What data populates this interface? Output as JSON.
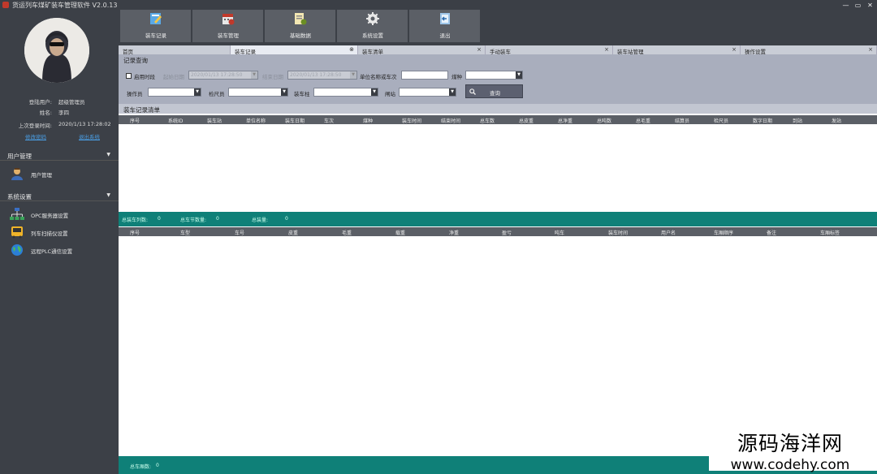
{
  "window": {
    "title": "货运列车煤矿装车管理软件 V2.0.13",
    "controls": [
      "—",
      "▭",
      "✕"
    ]
  },
  "user": {
    "login_user_label": "登陆用户:",
    "login_user": "超级管理员",
    "name_label": "姓名:",
    "name": "李四",
    "last_login_label": "上次登录时间:",
    "last_login": "2020/1/13 17:28:02",
    "link_change_password": "修改密码",
    "link_logout": "退出系统"
  },
  "sidebar": {
    "sections": [
      {
        "label": "用户管理",
        "items": [
          {
            "label": "用户管理",
            "icon": "user-icon"
          }
        ]
      },
      {
        "label": "系统设置",
        "items": [
          {
            "label": "OPC服务器设置",
            "icon": "network-icon"
          },
          {
            "label": "列车扫描仪设置",
            "icon": "train-scanner-icon"
          },
          {
            "label": "远程PLC通信设置",
            "icon": "globe-icon"
          }
        ]
      }
    ]
  },
  "toolbar": {
    "buttons": [
      {
        "label": "装车记录",
        "icon": "record-icon"
      },
      {
        "label": "装车管理",
        "icon": "calendar-icon"
      },
      {
        "label": "基础数据",
        "icon": "data-icon"
      },
      {
        "label": "系统设置",
        "icon": "gear-icon"
      },
      {
        "label": "退出",
        "icon": "exit-icon"
      }
    ]
  },
  "tabs": [
    {
      "label": "首页",
      "closable": false,
      "active": false
    },
    {
      "label": "装车记录",
      "closable": true,
      "active": true
    },
    {
      "label": "装车清单",
      "closable": true,
      "active": false
    },
    {
      "label": "手动装车",
      "closable": true,
      "active": false
    },
    {
      "label": "装车站管理",
      "closable": true,
      "active": false
    },
    {
      "label": "操作设置",
      "closable": true,
      "active": false
    }
  ],
  "query": {
    "title": "记录查询",
    "enable_time_label": "启用时段",
    "start_date_label": "起始日期",
    "start_date_value": "2020/01/13 17:28:50",
    "end_date_label": "结束日期",
    "end_date_value": "2020/01/13 17:28:50",
    "unit_label": "单位名称或车次",
    "coal_label": "煤种",
    "operator_label": "操作员",
    "inspector_label": "检尺员",
    "station_label": "装车柱",
    "gate_label": "闸站",
    "query_button": "查询"
  },
  "record_list": {
    "title": "装车记录清单",
    "columns": [
      "序号",
      "系统ID",
      "装车站",
      "单位名称",
      "装车日期",
      "车次",
      "煤种",
      "装车时间",
      "结束时间",
      "总车数",
      "总皮重",
      "总净重",
      "总吨数",
      "总毛重",
      "结算员",
      "检尺员",
      "数字日期",
      "到站",
      "发站"
    ],
    "status": {
      "total_trains_label": "总装车列数:",
      "total_trains": "0",
      "total_cars_label": "总车节数量:",
      "total_cars": "0",
      "total_weight_label": "总装量:",
      "total_weight": "0"
    }
  },
  "detail_list": {
    "columns": [
      "序号",
      "车型",
      "车号",
      "皮重",
      "毛重",
      "载重",
      "净重",
      "盈亏",
      "吨车",
      "装车时间",
      "用户名",
      "车厢顺序",
      "备注",
      "车厢标签"
    ],
    "status": {
      "total_cars_label": "总车厢数:",
      "total_cars": "0"
    }
  },
  "watermark": {
    "line1": "源码海洋网",
    "line2": "www.codehy.com"
  }
}
